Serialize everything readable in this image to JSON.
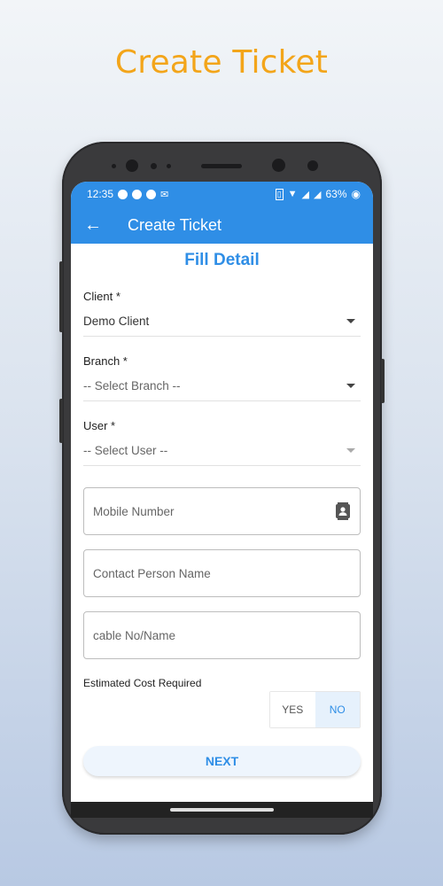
{
  "promo": {
    "title": "Create Ticket"
  },
  "status_bar": {
    "time": "12:35",
    "battery": "63%"
  },
  "app_bar": {
    "title": "Create Ticket"
  },
  "form": {
    "section_title": "Fill Detail",
    "client": {
      "label": "Client *",
      "value": "Demo Client"
    },
    "branch": {
      "label": "Branch *",
      "value": "-- Select Branch --"
    },
    "user": {
      "label": "User *",
      "value": "-- Select User --"
    },
    "mobile": {
      "placeholder": "Mobile Number"
    },
    "contact_person": {
      "placeholder": "Contact Person Name"
    },
    "cable": {
      "placeholder": "cable No/Name"
    },
    "cost": {
      "label": "Estimated Cost Required",
      "yes": "YES",
      "no": "NO",
      "selected": "NO"
    },
    "next_label": "NEXT"
  },
  "colors": {
    "accent": "#2f8ee6",
    "promo_title": "#f3a51a"
  }
}
